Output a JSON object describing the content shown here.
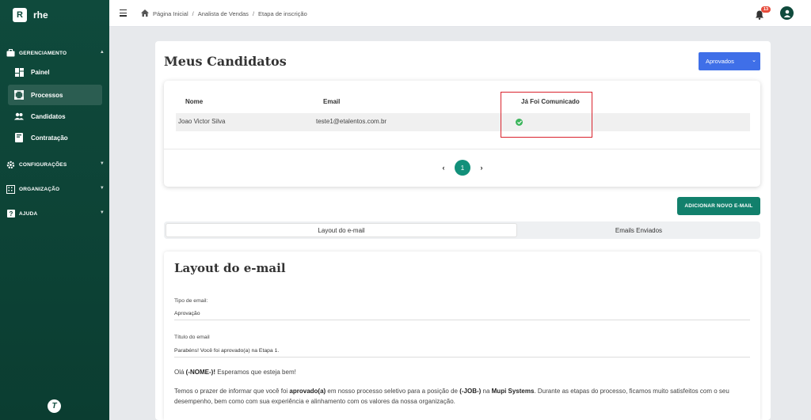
{
  "app": {
    "name": "rhe",
    "logo_letter": "R",
    "footer_logo": "T"
  },
  "sidebar": {
    "sections": [
      {
        "label": "GERENCIAMENTO",
        "icon": "briefcase-icon",
        "expanded": true
      },
      {
        "label": "CONFIGURAÇÕES",
        "icon": "gear-icon",
        "expanded": false
      },
      {
        "label": "ORGANIZAÇÃO",
        "icon": "building-icon",
        "expanded": false
      },
      {
        "label": "AJUDA",
        "icon": "help-icon",
        "expanded": false
      }
    ],
    "items": [
      {
        "label": "Painel",
        "icon": "dashboard-icon",
        "active": false
      },
      {
        "label": "Processos",
        "icon": "process-icon",
        "active": true
      },
      {
        "label": "Candidatos",
        "icon": "people-icon",
        "active": false
      },
      {
        "label": "Contratação",
        "icon": "contract-icon",
        "active": false
      }
    ]
  },
  "topbar": {
    "breadcrumb": [
      "Página Inicial",
      "Analista de Vendas",
      "Etapa de inscrição"
    ],
    "notifications_count": "13"
  },
  "main": {
    "title": "Meus Candidatos",
    "status_select": "Aprovados",
    "table": {
      "headers": [
        "Nome",
        "Email",
        "Já Foi Comunicado"
      ],
      "rows": [
        {
          "name": "Joao Victor Silva",
          "email": "teste1@etalentos.com.br",
          "communicated": true
        }
      ]
    },
    "pagination": {
      "current": "1",
      "prev": "‹",
      "next": "›"
    },
    "add_email_button": "ADICIONAR NOVO E-MAIL",
    "tabs": [
      "Layout do e-mail",
      "Emails Enviados"
    ],
    "layout": {
      "title": "Layout do e-mail",
      "type_label": "Tipo de email:",
      "type_value": "Aprovação",
      "subject_label": "Título do email",
      "subject_value": "Parabéns! Você foi aprovado(a) na Etapa 1.",
      "greeting_pre": "Olá ",
      "greeting_name": "(-NOME-)!",
      "greeting_post": " Esperamos que esteja bem!",
      "p1_a": "Temos o prazer de informar que você foi ",
      "p1_b": "aprovado(a)",
      "p1_c": " em nosso processo seletivo para a posição de ",
      "p1_d": "(-JOB-)",
      "p1_e": " na ",
      "p1_f": "Mupi Systems",
      "p1_g": ". Durante as etapas do processo, ficamos muito satisfeitos com o seu desempenho, bem como com sua experiência e alinhamento com os valores da nossa organização."
    }
  },
  "colors": {
    "sidebar": "#0f4a3c",
    "accent": "#12806c",
    "select": "#3f6fe8",
    "highlight": "#d9232d",
    "success": "#3cb55c"
  }
}
